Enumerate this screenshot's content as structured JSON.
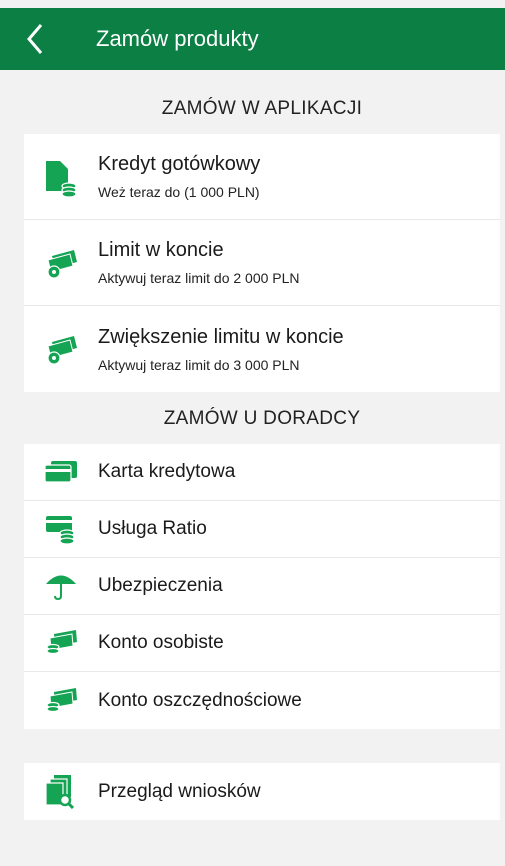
{
  "header": {
    "title": "Zamów produkty"
  },
  "section_app": {
    "title": "ZAMÓW W APLIKACJI",
    "items": [
      {
        "title": "Kredyt gotówkowy",
        "subtitle": "Weż teraz do  (1 000 PLN)",
        "icon": "cash-loan-icon"
      },
      {
        "title": "Limit w koncie",
        "subtitle": "Aktywuj teraz limit do  2 000 PLN",
        "icon": "money-icon"
      },
      {
        "title": "Zwiększenie limitu w koncie",
        "subtitle": "Aktywuj teraz limit do  3 000 PLN",
        "icon": "money-icon"
      }
    ]
  },
  "section_advisor": {
    "title": "ZAMÓW U DORADCY",
    "items": [
      {
        "title": "Karta kredytowa",
        "icon": "credit-card-icon"
      },
      {
        "title": "Usługa Ratio",
        "icon": "card-coins-icon"
      },
      {
        "title": "Ubezpieczenia",
        "icon": "umbrella-icon"
      },
      {
        "title": "Konto osobiste",
        "icon": "banknote-icon"
      },
      {
        "title": "Konto oszczędnościowe",
        "icon": "banknote-icon"
      }
    ]
  },
  "applications": {
    "title": "Przegląd wniosków",
    "icon": "document-search-icon"
  },
  "colors": {
    "brand": "#0b7f44",
    "icon": "#15a454",
    "background": "#f2f2f2"
  }
}
